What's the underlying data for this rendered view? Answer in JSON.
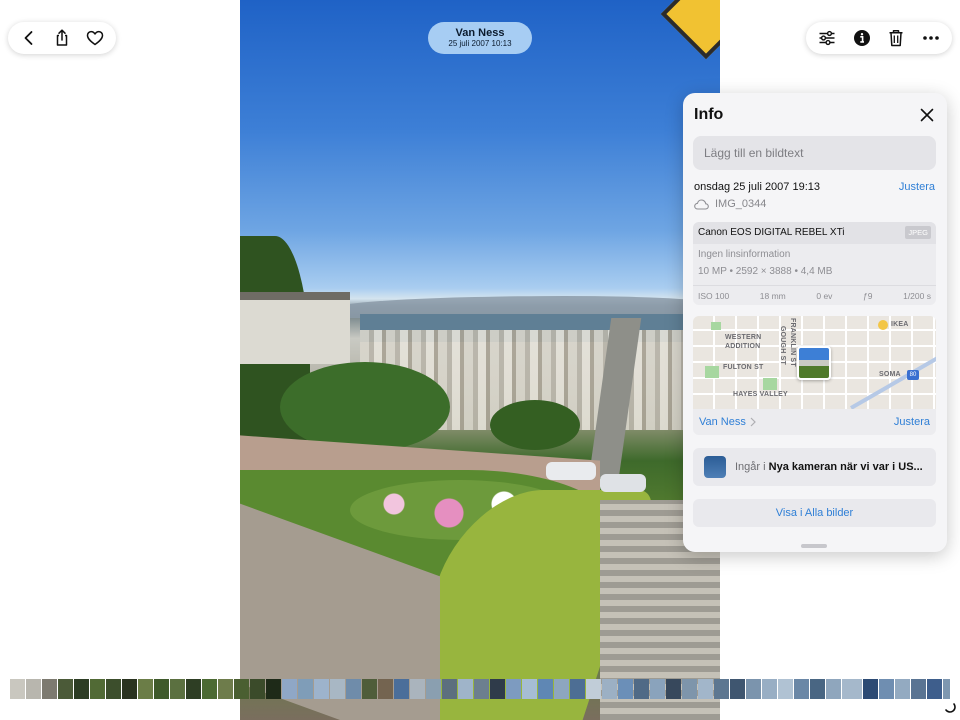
{
  "toolbar_left": {
    "back_icon": "chevron-left-icon",
    "share_icon": "share-icon",
    "favorite_icon": "heart-icon"
  },
  "title_pill": {
    "place": "Van Ness",
    "datetime": "25 juli 2007  10:13"
  },
  "toolbar_right": {
    "adjust_icon": "sliders-icon",
    "info_icon": "info-icon",
    "delete_icon": "trash-icon",
    "more_icon": "ellipsis-icon"
  },
  "info": {
    "title": "Info",
    "caption_placeholder": "Lägg till en bildtext",
    "datetime": "onsdag 25 juli 2007 19:13",
    "datetime_action": "Justera",
    "filename": "IMG_0344",
    "camera": "Canon EOS DIGITAL REBEL XTi",
    "format_badge": "JPEG",
    "lens": "Ingen linsinformation",
    "specs": "10 MP  •  2592 × 3888  •  4,4 MB",
    "exif": [
      "ISO 100",
      "18 mm",
      "0 ev",
      "ƒ9",
      "1/200 s"
    ],
    "map_labels": {
      "western_addition_1": "WESTERN",
      "western_addition_2": "ADDITION",
      "fulton": "FULTON ST",
      "hayes": "HAYES VALLEY",
      "franklin": "FRANKLIN ST",
      "gough": "GOUGH ST",
      "ikea": "IKEA",
      "soma": "SOMA",
      "hw_80": "80"
    },
    "location": "Van Ness",
    "location_action": "Justera",
    "album_prefix": "Ingår i",
    "album_name": "Nya kameran när vi var i US...",
    "show_all": "Visa i Alla bilder"
  },
  "filmstrip_colors": [
    "#c9c7bf",
    "#b8b6ae",
    "#7d7a70",
    "#4b5a38",
    "#2d3d24",
    "#516a35",
    "#3c4e2c",
    "#2a3320",
    "#6b7d47",
    "#3f5a2b",
    "#5b7040",
    "#2e3e24",
    "#4c6a33",
    "#6e7c4b",
    "#4a5f31",
    "#3b4b2a",
    "#1e2a18",
    "#8fa7c6",
    "#7f9db8",
    "#9db3cc",
    "#a8b7c4",
    "#6f8caa",
    "#4f5d3a",
    "#746450",
    "#4b6e9a",
    "#aab4bd",
    "#8a9fb0",
    "#5c6f7e",
    "#9fb4c9",
    "#6c7f8f",
    "#2f3b4a",
    "#7d9bc0",
    "#a6bdd4",
    "#5f87b4",
    "#8da6bf",
    "#4d6e94",
    "#c1cdd8",
    "#9cb0c4",
    "#6b8fb8",
    "#506a86",
    "#8aa3bc",
    "#37485c",
    "#7e95ab",
    "#a2b6ca",
    "#5d7791",
    "#3f5670",
    "#7b94ad",
    "#98aec4",
    "#b0c2d3",
    "#6a87a6",
    "#496683",
    "#8fa6bd",
    "#a5b8cb",
    "#2c4a74",
    "#6f8eb1",
    "#93aac1",
    "#5a7493",
    "#3e5e8c",
    "#7e97b0",
    "#a3b7ca",
    "#6b8aab",
    "#48698f",
    "#8ba3bb",
    "#b3c4d4",
    "#5f7c9c",
    "#3d5a7d",
    "#859db5"
  ],
  "current_frame_index": 52
}
